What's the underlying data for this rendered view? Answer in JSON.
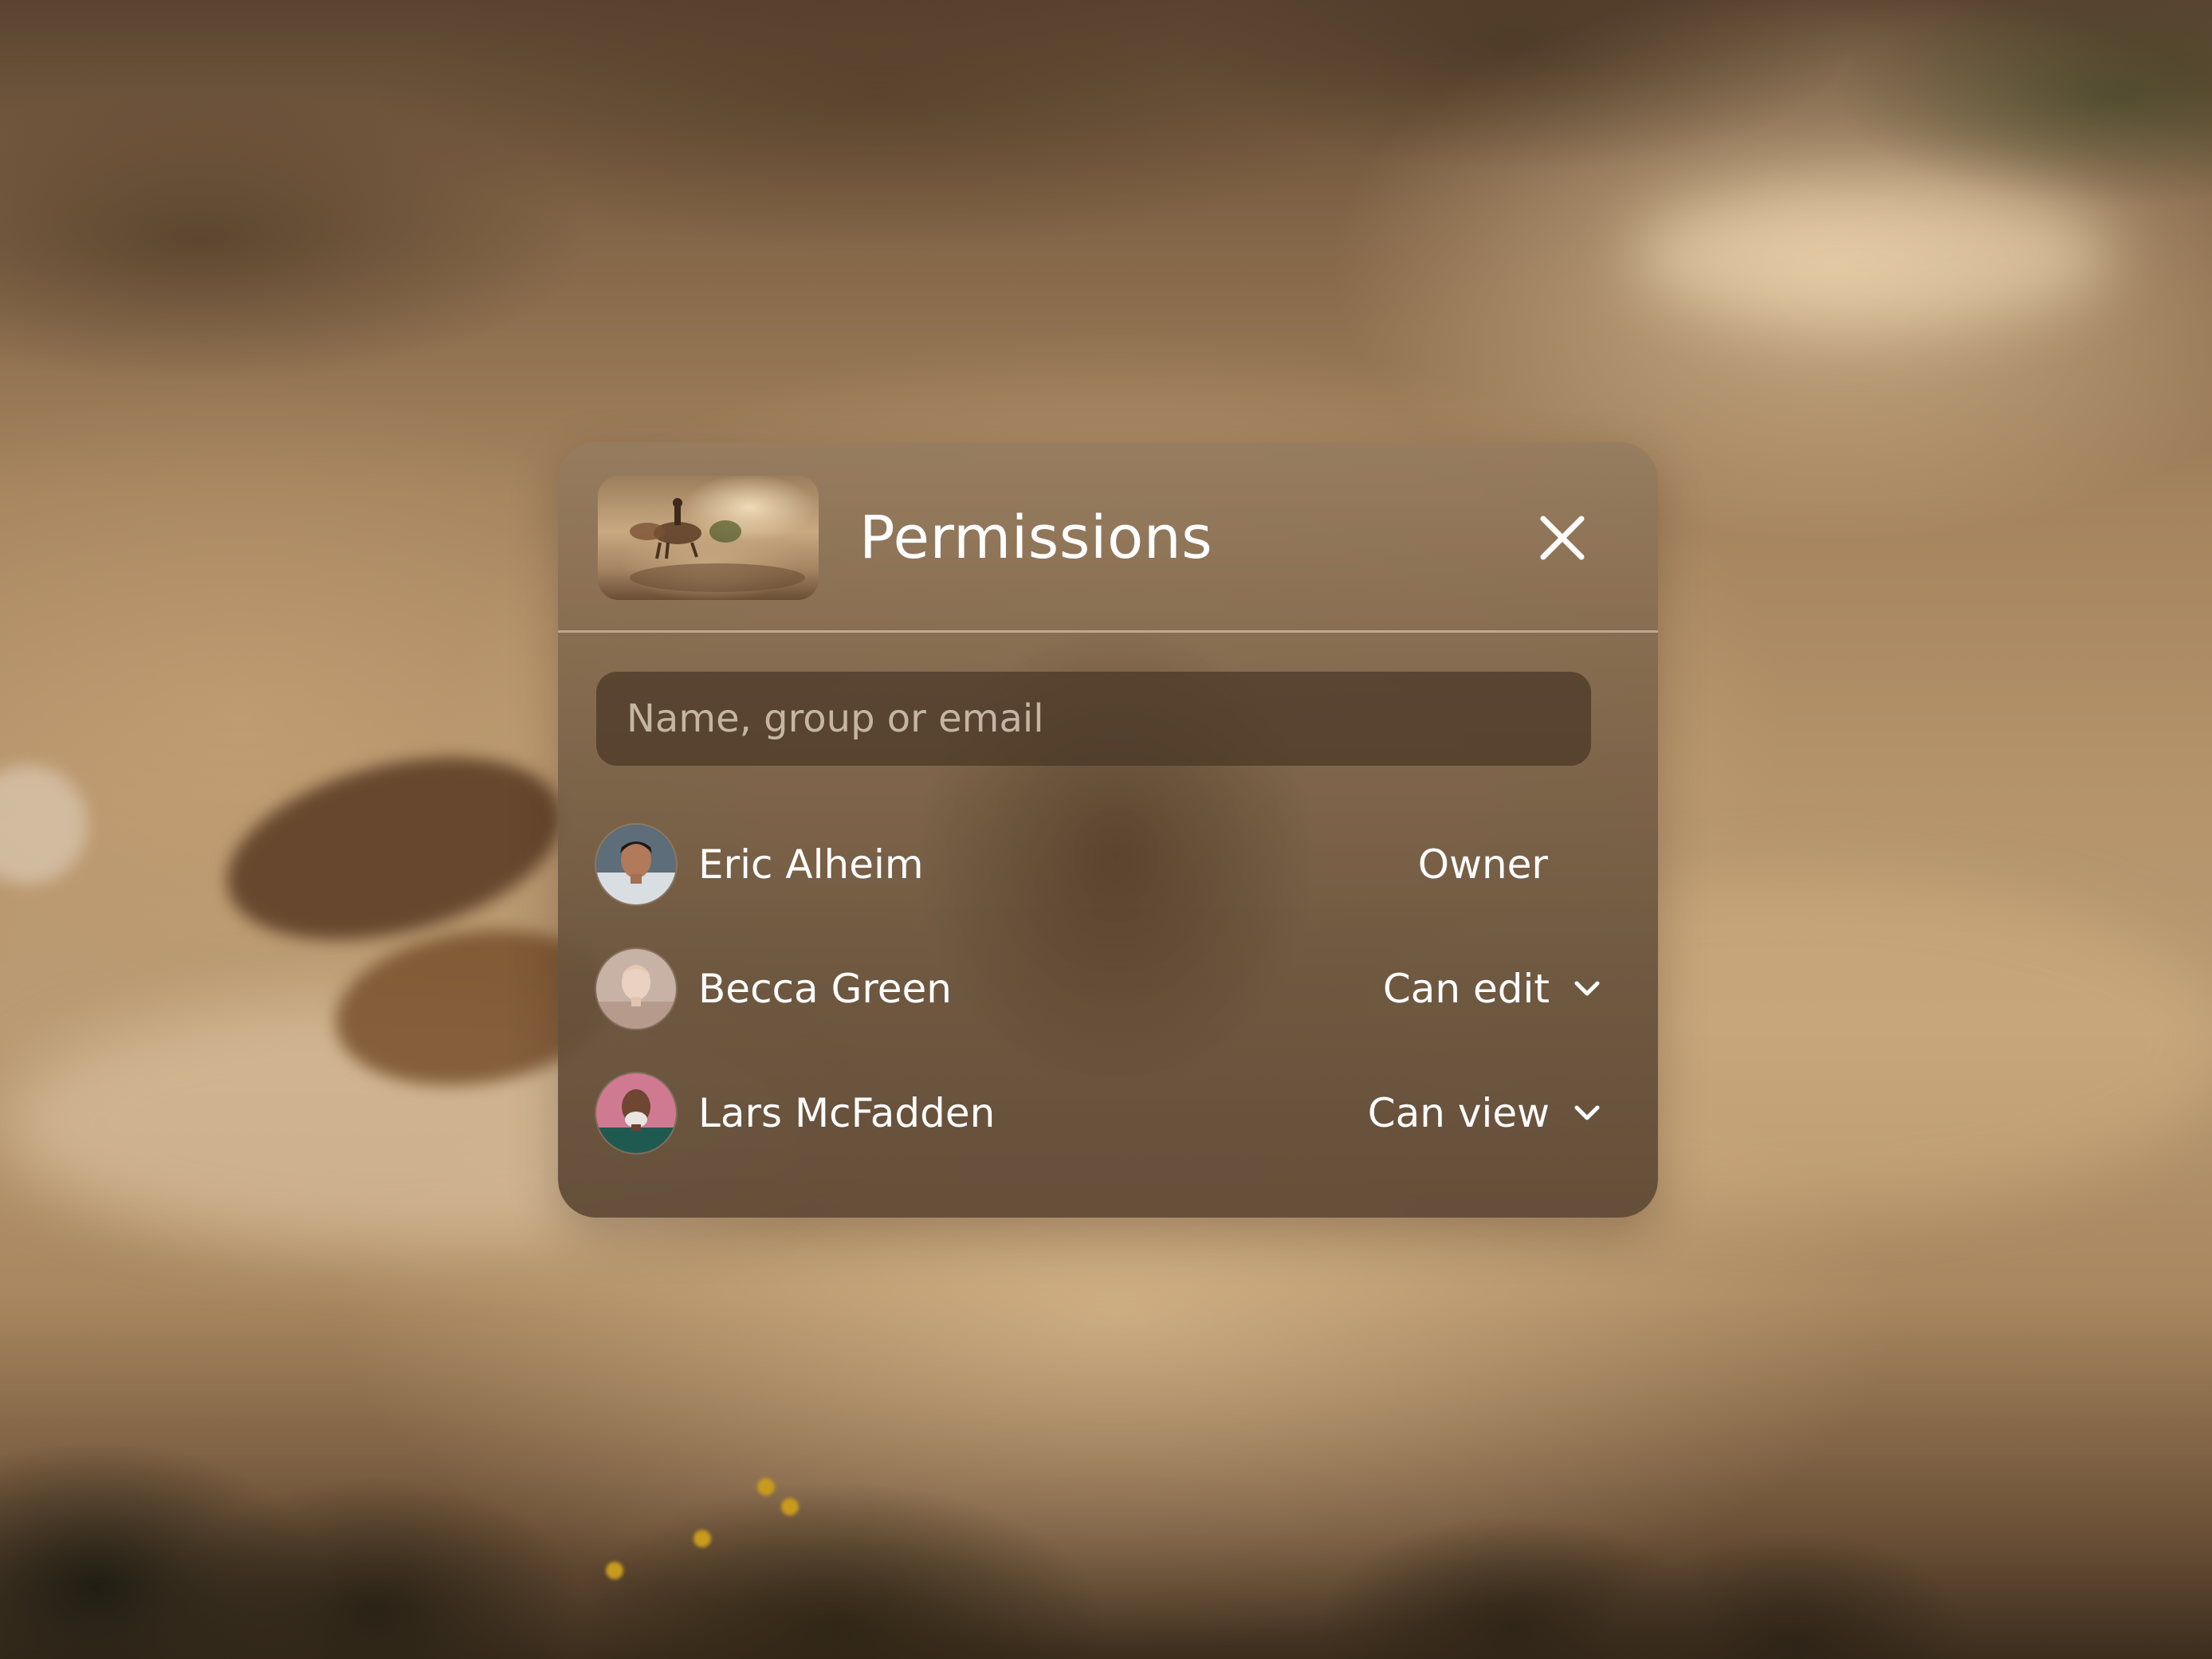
{
  "panel": {
    "title": "Permissions",
    "close_icon": "close-icon",
    "thumbnail_icon": "document-thumbnail"
  },
  "search": {
    "placeholder": "Name, group or email",
    "value": ""
  },
  "users": [
    {
      "name": "Eric Alheim",
      "role": "Owner",
      "editable": false,
      "avatar": "avatar-eric",
      "avatar_color": "#6b7a86"
    },
    {
      "name": "Becca Green",
      "role": "Can edit",
      "editable": true,
      "avatar": "avatar-becca",
      "avatar_color": "#c9b3a6"
    },
    {
      "name": "Lars McFadden",
      "role": "Can view",
      "editable": true,
      "avatar": "avatar-lars",
      "avatar_color": "#d27a93"
    }
  ],
  "colors": {
    "panel_text": "#ffffff",
    "panel_bg": "#8a6b4d",
    "search_bg": "#4a3626"
  }
}
